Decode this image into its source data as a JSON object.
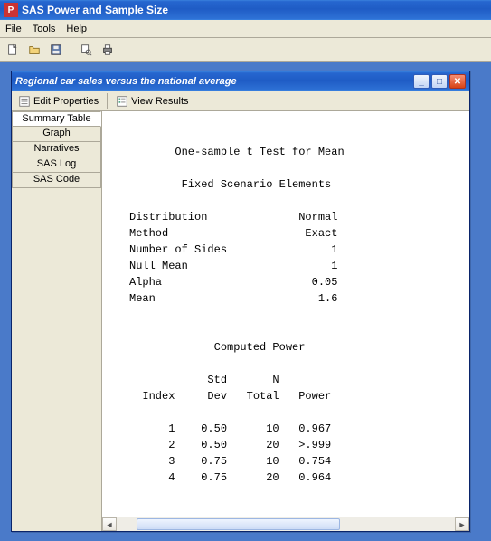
{
  "app": {
    "title": "SAS Power and Sample Size"
  },
  "menu": {
    "file": "File",
    "tools": "Tools",
    "help": "Help"
  },
  "inner": {
    "title": "Regional car sales versus the national average",
    "editProps": "Edit Properties",
    "viewResults": "View Results"
  },
  "sidebar": {
    "items": [
      {
        "label": "Summary Table"
      },
      {
        "label": "Graph"
      },
      {
        "label": "Narratives"
      },
      {
        "label": "SAS Log"
      },
      {
        "label": "SAS Code"
      }
    ]
  },
  "report": {
    "title": "One-sample t Test for Mean",
    "scenarioHeader": "Fixed Scenario Elements",
    "fixed": [
      {
        "label": "Distribution",
        "value": "Normal"
      },
      {
        "label": "Method",
        "value": "Exact"
      },
      {
        "label": "Number of Sides",
        "value": "1"
      },
      {
        "label": "Null Mean",
        "value": "1"
      },
      {
        "label": "Alpha",
        "value": "0.05"
      },
      {
        "label": "Mean",
        "value": "1.6"
      }
    ],
    "computedHeader": "Computed Power",
    "cols": {
      "c1": "Index",
      "c2h1": "Std",
      "c2h2": "Dev",
      "c3h1": "N",
      "c3h2": "Total",
      "c4": "Power"
    },
    "rows": [
      {
        "index": "1",
        "stddev": "0.50",
        "n": "10",
        "power": "0.967"
      },
      {
        "index": "2",
        "stddev": "0.50",
        "n": "20",
        "power": ">.999"
      },
      {
        "index": "3",
        "stddev": "0.75",
        "n": "10",
        "power": "0.754"
      },
      {
        "index": "4",
        "stddev": "0.75",
        "n": "20",
        "power": "0.964"
      }
    ]
  }
}
